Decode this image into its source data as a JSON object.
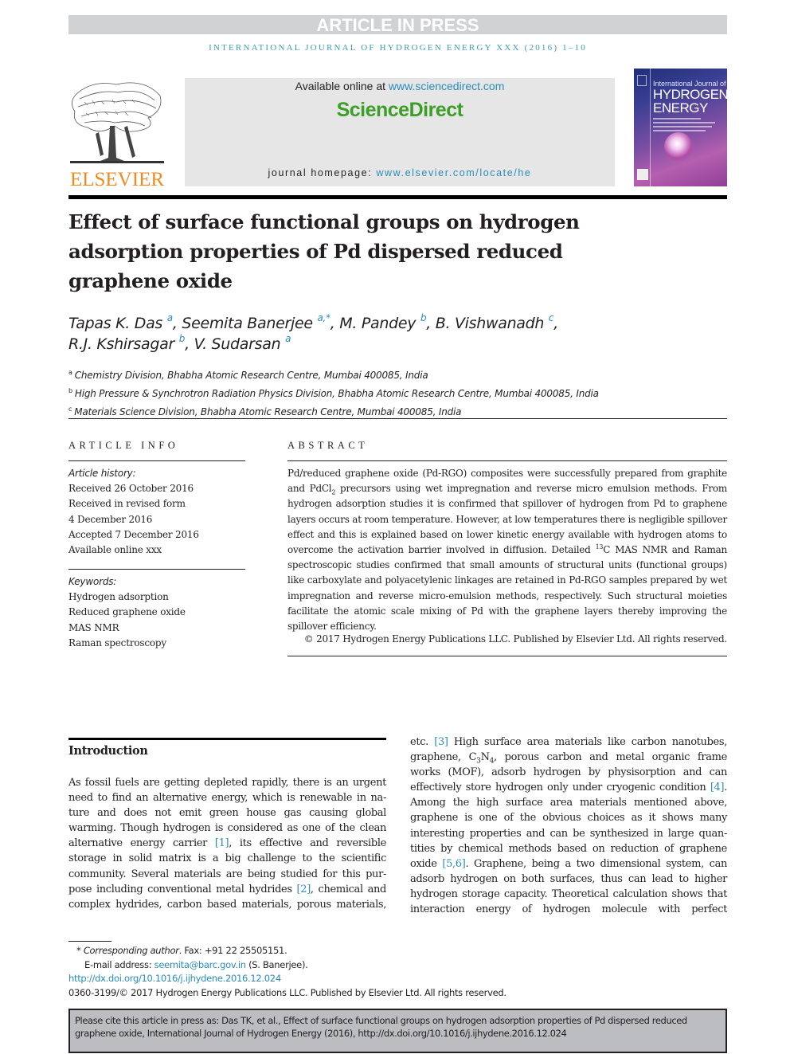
{
  "header": {
    "banner": "ARTICLE IN PRESS",
    "journal_line": "INTERNATIONAL JOURNAL OF HYDROGEN ENERGY XXX (2016) 1–10"
  },
  "masthead": {
    "publisher_logo_text": "ELSEVIER",
    "available_online_prefix": "Available online at ",
    "available_online_link": "www.sciencedirect.com",
    "brand": "ScienceDirect",
    "homepage_prefix": "journal homepage: ",
    "homepage_link": "www.elsevier.com/locate/he",
    "cover": {
      "line1": "International Journal of",
      "line2": "HYDROGEN",
      "line3": "ENERGY"
    }
  },
  "article": {
    "title": "Effect of surface functional groups on hydrogen adsorption properties of Pd dispersed reduced graphene oxide",
    "authors": [
      {
        "name": "Tapas K. Das",
        "aff": "a",
        "sep": ", "
      },
      {
        "name": "Seemita Banerjee",
        "aff": "a,*",
        "sep": ", "
      },
      {
        "name": "M. Pandey",
        "aff": "b",
        "sep": ", "
      },
      {
        "name": "B. Vishwanadh",
        "aff": "c",
        "sep": ","
      },
      {
        "name": "R.J. Kshirsagar",
        "aff": "b",
        "sep": ", "
      },
      {
        "name": "V. Sudarsan",
        "aff": "a",
        "sep": ""
      }
    ],
    "affiliations": [
      {
        "key": "a",
        "text": "Chemistry Division, Bhabha Atomic Research Centre, Mumbai 400085, India"
      },
      {
        "key": "b",
        "text": "High Pressure & Synchrotron Radiation Physics Division, Bhabha Atomic Research Centre, Mumbai 400085, India"
      },
      {
        "key": "c",
        "text": "Materials Science Division, Bhabha Atomic Research Centre, Mumbai 400085, India"
      }
    ]
  },
  "article_info": {
    "heading": "ARTICLE INFO",
    "history_label": "Article history:",
    "history": [
      "Received 26 October 2016",
      "Received in revised form",
      "4 December 2016",
      "Accepted 7 December 2016",
      "Available online xxx"
    ],
    "keywords_label": "Keywords:",
    "keywords": [
      "Hydrogen adsorption",
      "Reduced graphene oxide",
      "MAS NMR",
      "Raman spectroscopy"
    ]
  },
  "abstract": {
    "heading": "ABSTRACT",
    "p1": "Pd/reduced graphene oxide (Pd-RGO) composites were successfully prepared from graphite and PdCl",
    "p1_sub": "2",
    "p2": " precursors using wet impregnation and reverse micro emulsion methods. From hydrogen adsorption studies it is confirmed that spillover of hydrogen from Pd to graphene layers occurs at room temperature. However, at low temperatures there is negligible spillover effect and this is explained based on lower kinetic energy available with hydrogen atoms to overcome the activation barrier involved in diffusion. Detailed ",
    "p2_sup": "13",
    "p3": "C MAS NMR and Raman spectroscopic studies confirmed that small amounts of structural units (functional groups) like carboxylate and polyacetylenic linkages are retained in Pd-RGO samples prepared by wet impregnation and reverse micro-emulsion methods, respectively. Such structural moieties facilitate the atomic scale mixing of Pd with the graphene layers thereby improving the spillover efficiency.",
    "copyright": "© 2017 Hydrogen Energy Publications LLC. Published by Elsevier Ltd. All rights reserved."
  },
  "introduction": {
    "heading": "Introduction",
    "left_lines": [
      "As fossil fuels are getting depleted rapidly, there is an urgent",
      "need to find an alternative energy, which is renewable in na-",
      "ture and does not emit green house gas causing global",
      "warming. Though hydrogen is considered as one of the clean"
    ],
    "left_l5_a": "alternative energy carrier ",
    "ref1": "[1]",
    "left_l5_b": ", its effective and reversible",
    "left_l6": "storage in solid matrix is a big challenge to the scientific",
    "left_l7": "community. Several materials are being studied for this pur-",
    "left_l8_a": "pose including conventional metal hydrides ",
    "ref2": "[2]",
    "left_l8_b": ", chemical and",
    "left_l9": "complex hydrides, carbon based materials, porous materials,",
    "right_l1_a": "etc. ",
    "ref3": "[3]",
    "right_l1_b": " High surface area materials like carbon nanotubes,",
    "right_l2_a": "graphene, C",
    "right_l2_sub1": "3",
    "right_l2_b": "N",
    "right_l2_sub2": "4",
    "right_l2_c": ", porous carbon and metal organic frame",
    "right_l3": "works (MOF), adsorb hydrogen by physisorption and can",
    "right_l4_a": "effectively store hydrogen only under cryogenic condition ",
    "ref4": "[4]",
    "right_l4_b": ".",
    "right_l5": "Among the high surface area materials mentioned above,",
    "right_l6": "graphene is one of the obvious choices as it shows many",
    "right_l7": "interesting properties and can be synthesized in large quan-",
    "right_l8": "tities by chemical methods based on reduction of graphene",
    "right_l9_a": "oxide ",
    "ref56": "[5,6]",
    "right_l9_b": ". Graphene, being a two dimensional system, can",
    "right_l10": "adsorb hydrogen on both surfaces, thus can lead to higher",
    "right_l11": "hydrogen storage capacity. Theoretical calculation shows that",
    "right_l12": "interaction energy of hydrogen molecule with perfect"
  },
  "footnotes": {
    "star": "* ",
    "corr_label": "Corresponding author",
    "corr_rest": ". Fax: +91 22 25505151.",
    "email_label": "E-mail address: ",
    "email": "seemita@barc.gov.in",
    "email_rest": " (S. Banerjee).",
    "doi": "http://dx.doi.org/10.1016/j.ijhydene.2016.12.024",
    "issn_line": "0360-3199/© 2017 Hydrogen Energy Publications LLC. Published by Elsevier Ltd. All rights reserved."
  },
  "cite_box": {
    "text": "Please cite this article in press as: Das TK, et al., Effect of surface functional groups on hydrogen adsorption properties of Pd dispersed reduced graphene oxide, International Journal of Hydrogen Energy (2016), http://dx.doi.org/10.1016/j.ijhydene.2016.12.024"
  },
  "colors": {
    "link": "#2a8cba",
    "sciencedirect_green": "#3c9e26",
    "elsevier_orange": "#f08b1d",
    "banner_gray": "#d1d2d4"
  }
}
